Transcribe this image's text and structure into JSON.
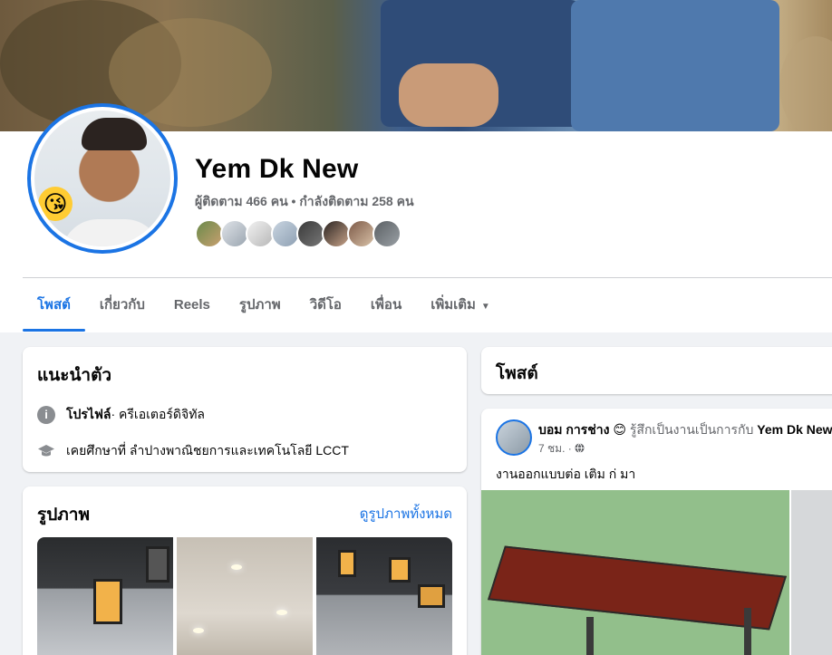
{
  "profile": {
    "name": "Yem Dk New",
    "follow_stats": "ผู้ติดตาม 466 คน • กำลังติดตาม 258 คน"
  },
  "tabs": [
    {
      "label": "โพสต์"
    },
    {
      "label": "เกี่ยวกับ"
    },
    {
      "label": "Reels"
    },
    {
      "label": "รูปภาพ"
    },
    {
      "label": "วิดีโอ"
    },
    {
      "label": "เพื่อน"
    },
    {
      "label": "เพิ่มเติม"
    }
  ],
  "intro": {
    "title": "แนะนำตัว",
    "profile_label": "โปรไฟล์",
    "profile_value": " · ครีเอเตอร์ดิจิทัล",
    "education": "เคยศึกษาที่ ลำปางพาณิชยการและเทคโนโลยี LCCT"
  },
  "photos": {
    "title": "รูปภาพ",
    "see_all": "ดูรูปภาพทั้งหมด"
  },
  "posts": {
    "title": "โพสต์",
    "author": "บอม การช่าง",
    "feeling": "รู้สึกเป็นงานเป็นการกับ",
    "tagged": "Yem Dk New",
    "time": "7 ชม. ·",
    "text": "งานออกแบบต่อ  เติม ก่ มา"
  },
  "icons": {
    "info": "info-icon",
    "education": "graduation-cap-icon",
    "globe": "globe-icon",
    "caret": "caret-down-icon",
    "emoji": "kiss-emoji-icon"
  },
  "colors": {
    "accent": "#1b74e4",
    "background": "#f0f2f5",
    "secondary_text": "#65676b"
  }
}
